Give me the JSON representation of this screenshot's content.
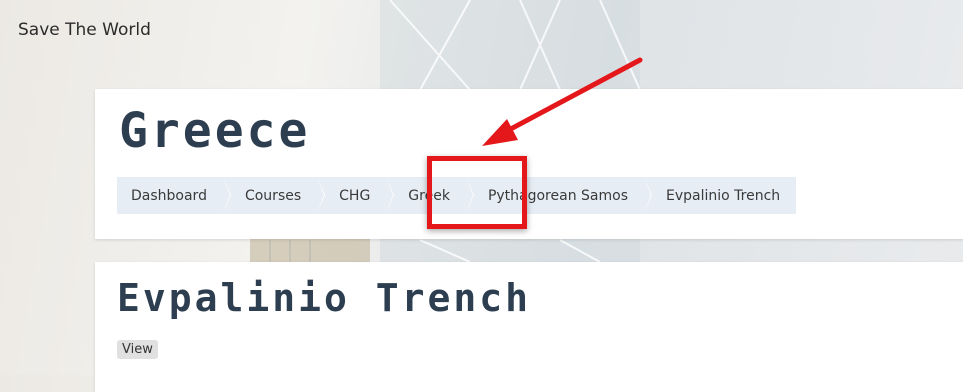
{
  "site": {
    "name": "Save The World"
  },
  "header": {
    "title": "Greece",
    "breadcrumb": [
      {
        "label": "Dashboard"
      },
      {
        "label": "Courses"
      },
      {
        "label": "CHG"
      },
      {
        "label": "Greek"
      },
      {
        "label": "Pythagorean Samos"
      },
      {
        "label": "Evpalinio Trench"
      }
    ]
  },
  "content": {
    "title": "Evpalinio Trench",
    "tabs": [
      {
        "label": "View"
      }
    ]
  },
  "annotation": {
    "highlight_color": "#e4171b",
    "highlighted_item": "Greek"
  }
}
